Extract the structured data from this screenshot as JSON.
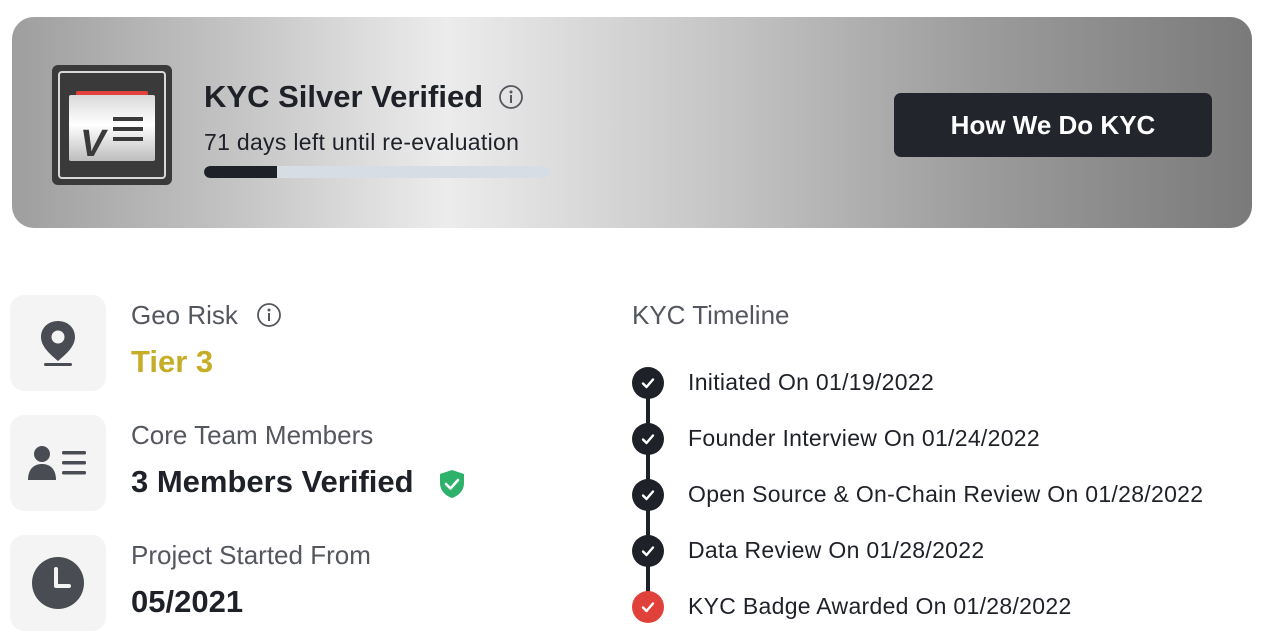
{
  "banner": {
    "title": "KYC Silver Verified",
    "subtitle": "71 days left until re-evaluation",
    "progress_fraction": 0.21,
    "cta_label": "How We Do KYC",
    "badge_letter": "V"
  },
  "stats": [
    {
      "label": "Geo Risk",
      "value": "Tier 3",
      "icon": "location-pin-icon"
    },
    {
      "label": "Core Team Members",
      "value": "3 Members Verified",
      "icon": "id-card-icon"
    },
    {
      "label": "Project Started From",
      "value": "05/2021",
      "icon": "clock-icon"
    }
  ],
  "timeline": {
    "title": "KYC Timeline",
    "items": [
      {
        "text": "Initiated On 01/19/2022",
        "status": "done"
      },
      {
        "text": "Founder Interview On 01/24/2022",
        "status": "done"
      },
      {
        "text": "Open Source & On-Chain Review On 01/28/2022",
        "status": "done"
      },
      {
        "text": "Data Review On 01/28/2022",
        "status": "done"
      },
      {
        "text": "KYC Badge Awarded On 01/28/2022",
        "status": "final"
      }
    ]
  },
  "colors": {
    "accent_dark": "#1f2129",
    "tier_yellow": "#c6ad28",
    "verified_green": "#2eb16b",
    "final_red": "#e0413a"
  }
}
